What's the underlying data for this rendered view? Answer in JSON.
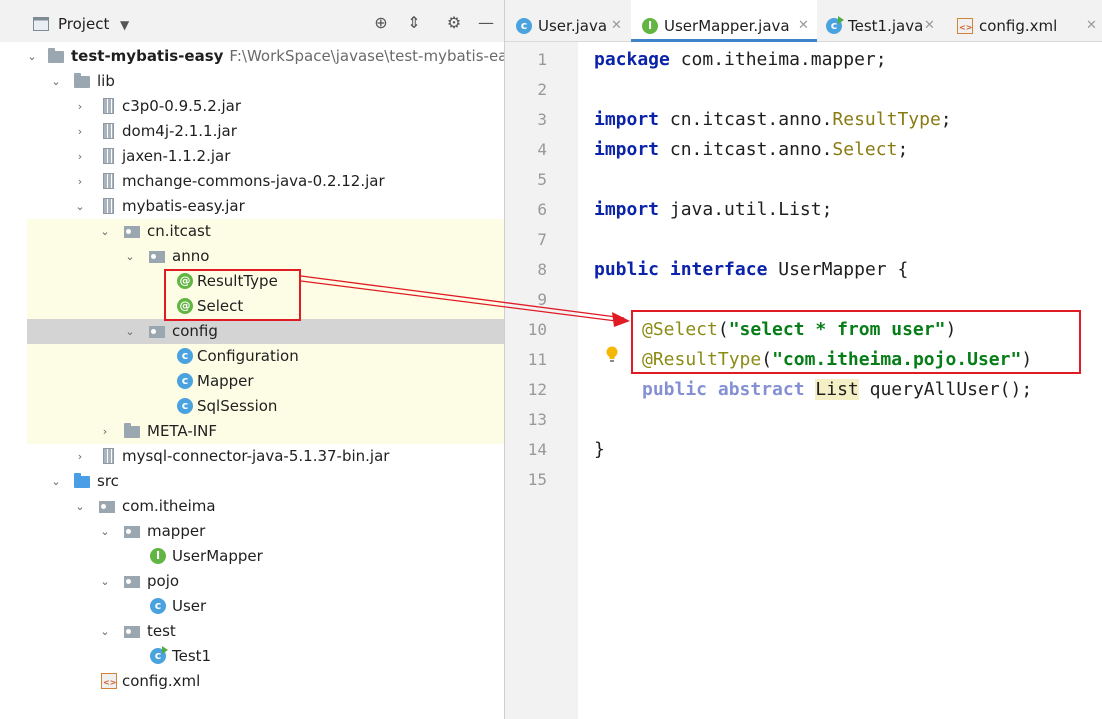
{
  "project_panel": {
    "title": "Project",
    "tree": [
      {
        "label": "test-mybatis-easy",
        "path": "F:\\WorkSpace\\javase\\test-mybatis-easy"
      },
      {
        "label": "lib"
      },
      {
        "label": "c3p0-0.9.5.2.jar"
      },
      {
        "label": "dom4j-2.1.1.jar"
      },
      {
        "label": "jaxen-1.1.2.jar"
      },
      {
        "label": "mchange-commons-java-0.2.12.jar"
      },
      {
        "label": "mybatis-easy.jar"
      },
      {
        "label": "cn.itcast"
      },
      {
        "label": "anno"
      },
      {
        "label": "ResultType"
      },
      {
        "label": "Select"
      },
      {
        "label": "config"
      },
      {
        "label": "Configuration"
      },
      {
        "label": "Mapper"
      },
      {
        "label": "SqlSession"
      },
      {
        "label": "META-INF"
      },
      {
        "label": "mysql-connector-java-5.1.37-bin.jar"
      },
      {
        "label": "src"
      },
      {
        "label": "com.itheima"
      },
      {
        "label": "mapper"
      },
      {
        "label": "UserMapper"
      },
      {
        "label": "pojo"
      },
      {
        "label": "User"
      },
      {
        "label": "test"
      },
      {
        "label": "Test1"
      },
      {
        "label": "config.xml"
      }
    ]
  },
  "editor": {
    "tabs": [
      {
        "label": "User.java",
        "icon": "class-icon"
      },
      {
        "label": "UserMapper.java",
        "icon": "interface-icon",
        "active": true
      },
      {
        "label": "Test1.java",
        "icon": "runnable-class-icon"
      },
      {
        "label": "config.xml",
        "icon": "xml-file-icon"
      }
    ],
    "line_numbers": [
      "1",
      "2",
      "3",
      "4",
      "5",
      "6",
      "7",
      "8",
      "9",
      "10",
      "11",
      "12",
      "13",
      "14",
      "15"
    ],
    "code": {
      "l1_kw": "package",
      "l1_rest": " com.itheima.mapper;",
      "l3_kw": "import",
      "l3_pkg": " cn.itcast.anno.",
      "l3_cls": "ResultType",
      "l3_end": ";",
      "l4_kw": "import",
      "l4_pkg": " cn.itcast.anno.",
      "l4_cls": "Select",
      "l4_end": ";",
      "l6_kw": "import",
      "l6_rest": " java.util.List;",
      "l8_kw1": "public",
      "l8_kw2": "interface",
      "l8_rest": " UserMapper {",
      "l10_ann": "@Select",
      "l10_p1": "(",
      "l10_str": "\"select * from user\"",
      "l10_p2": ")",
      "l11_ann": "@ResultType",
      "l11_p1": "(",
      "l11_str": "\"com.itheima.pojo.User\"",
      "l11_p2": ")",
      "l12_kw1": "public",
      "l12_kw2": "abstract",
      "l12_list": "List",
      "l12_rest": " queryAllUser();",
      "l14": "}"
    }
  },
  "colors": {
    "annotation_box": "#e01b24",
    "keyword": "#0b23a8",
    "string": "#067d17",
    "tab_underline": "#4083c9"
  }
}
